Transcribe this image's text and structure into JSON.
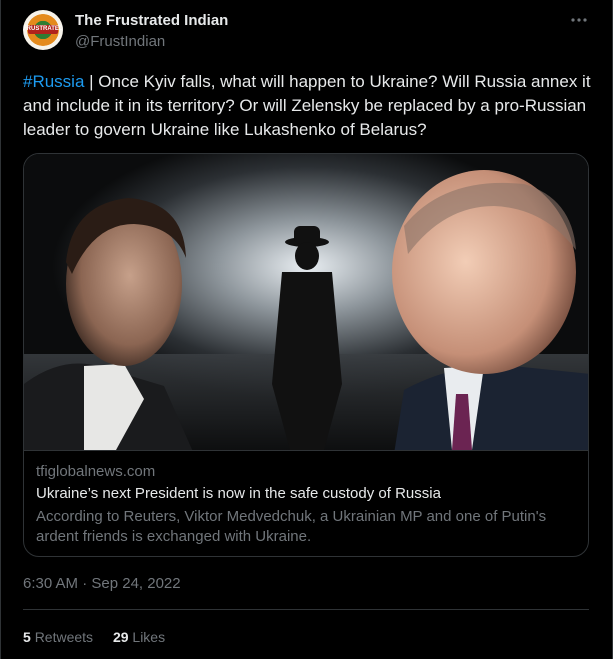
{
  "author": {
    "name": "The Frustrated Indian",
    "handle": "@FrustIndian",
    "avatar_text": "FRUSTRATED"
  },
  "tweet": {
    "hashtag": "#Russia",
    "text": " | Once Kyiv falls, what will happen to Ukraine? Will Russia annex it and include it in its territory? Or will Zelensky be replaced by a pro-Russian leader to govern Ukraine like Lukashenko of Belarus?"
  },
  "card": {
    "domain": "tfiglobalnews.com",
    "title": "Ukraine’s next President is now in the safe custody of Russia",
    "description": "According to Reuters, Viktor Medvedchuk, a Ukrainian MP and one of Putin's ardent friends is exchanged with Ukraine."
  },
  "timestamp": "6:30 AM · Sep 24, 2022",
  "stats": {
    "retweets_count": "5",
    "retweets_label": "Retweets",
    "likes_count": "29",
    "likes_label": "Likes"
  },
  "colors": {
    "background": "#000000",
    "text_primary": "#e7e9ea",
    "text_secondary": "#71767b",
    "link": "#1d9bf0",
    "border": "#2f3336"
  },
  "icons": {
    "more": "more-horizontal-icon"
  }
}
